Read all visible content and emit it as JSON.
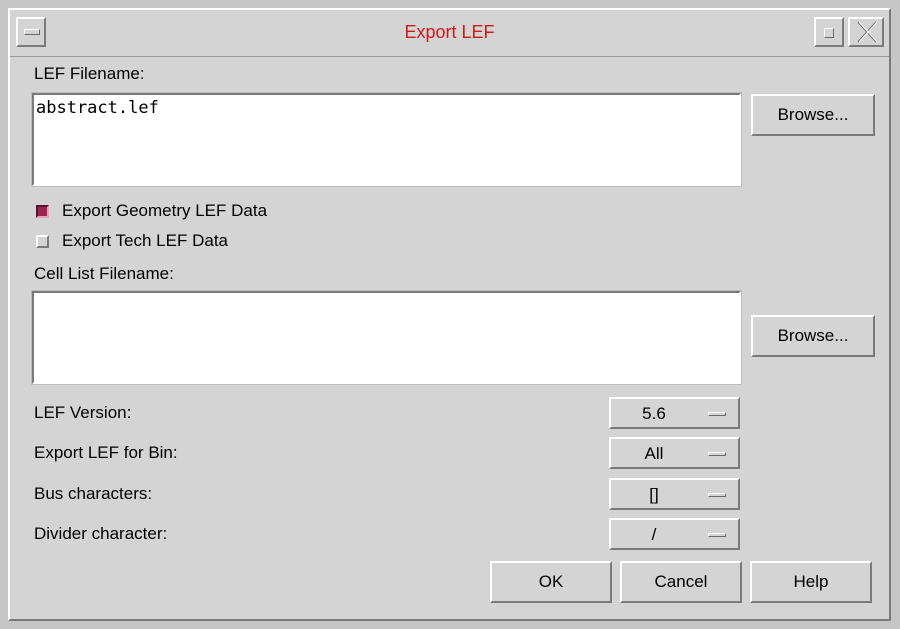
{
  "window": {
    "title": "Export LEF"
  },
  "lef_filename": {
    "label": "LEF Filename:",
    "value": "abstract.lef",
    "browse_label": "Browse..."
  },
  "options": {
    "geometry": {
      "label": "Export Geometry LEF Data",
      "checked": true
    },
    "tech": {
      "label": "Export Tech LEF Data",
      "checked": false
    }
  },
  "cell_list": {
    "label": "Cell List Filename:",
    "value": "",
    "browse_label": "Browse..."
  },
  "settings": {
    "lef_version": {
      "label": "LEF Version:",
      "value": "5.6"
    },
    "bin": {
      "label": "Export LEF for Bin:",
      "value": "All"
    },
    "bus_chars": {
      "label": "Bus characters:",
      "value": "[]"
    },
    "divider": {
      "label": "Divider character:",
      "value": "/"
    }
  },
  "buttons": {
    "ok": "OK",
    "cancel": "Cancel",
    "help": "Help"
  },
  "colors": {
    "title": "#cc1a1a",
    "checked": "#9e2450",
    "dialog_bg": "#d4d4d4"
  },
  "icons": {
    "window_menu": "window-menu-icon",
    "maximize": "maximize-icon",
    "close": "close-x-icon"
  }
}
